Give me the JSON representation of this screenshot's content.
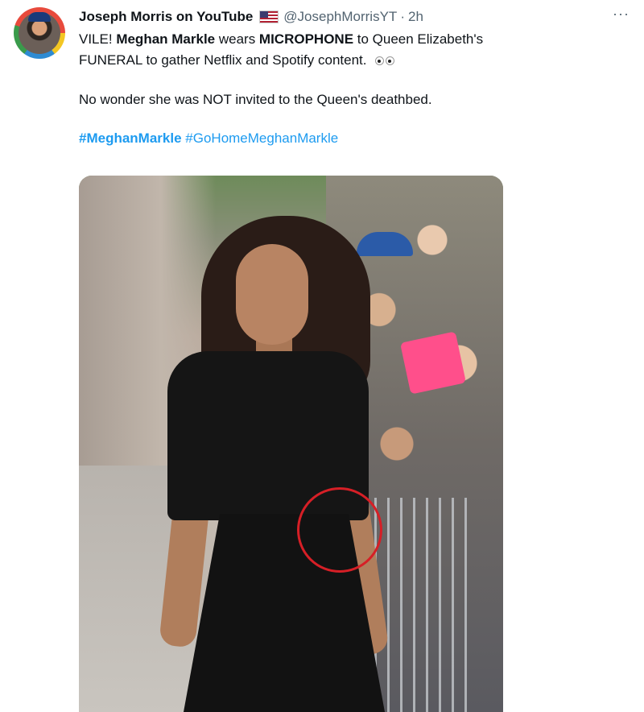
{
  "tweet": {
    "author": {
      "display_name": "Joseph Morris on YouTube",
      "flag": "US flag",
      "handle": "@JosephMorrisYT",
      "separator": "·",
      "time": "2h"
    },
    "more_label": "···",
    "text": {
      "line1_prefix": "VILE! ",
      "line1_bold1": "Meghan Markle",
      "line1_mid": " wears ",
      "line1_bold2": "MICROPHONE",
      "line1_suffix": " to Queen Elizabeth's",
      "line2": "FUNERAL to gather Netflix and Spotify content. ",
      "emoji": "eyes-emoji",
      "para2": "No wonder she was NOT invited to the Queen's deathbed."
    },
    "hashtags": [
      "#MeghanMarkle",
      "#GoHomeMeghanMarkle"
    ],
    "media": {
      "annotation_color": "#d61f26"
    }
  },
  "colors": {
    "text": "#0f1419",
    "secondary": "#536471",
    "link": "#1d9bf0"
  }
}
